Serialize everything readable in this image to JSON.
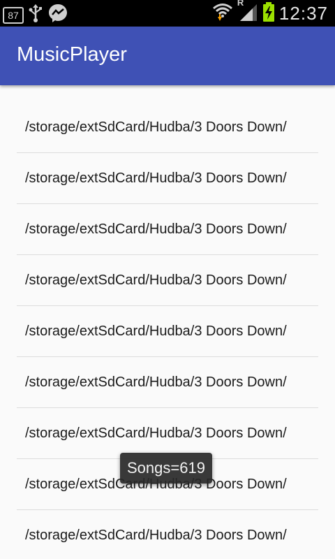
{
  "status_bar": {
    "notification_count": "87",
    "time": "12:37",
    "roaming_indicator": "R",
    "icons": [
      "usb-icon",
      "messenger-icon",
      "wifi-icon",
      "signal-icon",
      "battery-charging-icon"
    ]
  },
  "app_bar": {
    "title": "MusicPlayer",
    "background_color": "#3f51b5"
  },
  "songs": [
    {
      "path": "/storage/extSdCard/Hudba/3 Doors Down/"
    },
    {
      "path": "/storage/extSdCard/Hudba/3 Doors Down/"
    },
    {
      "path": "/storage/extSdCard/Hudba/3 Doors Down/"
    },
    {
      "path": "/storage/extSdCard/Hudba/3 Doors Down/"
    },
    {
      "path": "/storage/extSdCard/Hudba/3 Doors Down/"
    },
    {
      "path": "/storage/extSdCard/Hudba/3 Doors Down/"
    },
    {
      "path": "/storage/extSdCard/Hudba/3 Doors Down/"
    },
    {
      "path": "/storage/extSdCard/Hudba/3 Doors Down/"
    },
    {
      "path": "/storage/extSdCard/Hudba/3 Doors Down/"
    }
  ],
  "toast": {
    "text": "Songs=619"
  }
}
